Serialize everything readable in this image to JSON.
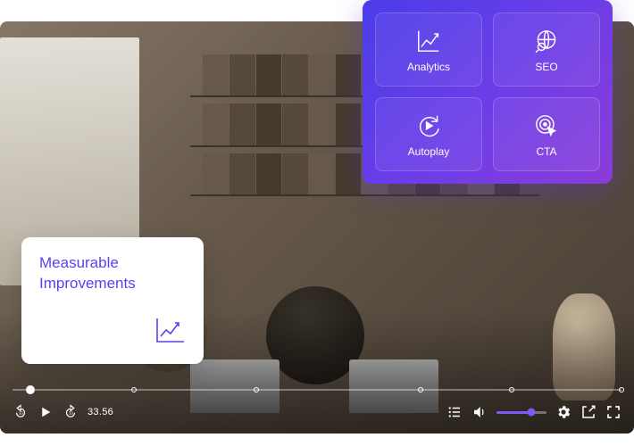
{
  "info_card": {
    "title": "Measurable Improvements"
  },
  "features": [
    {
      "label": "Analytics",
      "icon": "analytics-icon"
    },
    {
      "label": "SEO",
      "icon": "seo-icon"
    },
    {
      "label": "Autoplay",
      "icon": "autoplay-icon"
    },
    {
      "label": "CTA",
      "icon": "cta-icon"
    }
  ],
  "player": {
    "time": "33.56",
    "volume_percent": 70,
    "timeline_markers_percent": [
      3,
      20,
      40,
      67,
      82,
      100
    ],
    "playhead_percent": 3
  },
  "colors": {
    "accent": "#5b3ff0",
    "gradient_start": "#4a3de8",
    "gradient_end": "#8b3dd8"
  }
}
